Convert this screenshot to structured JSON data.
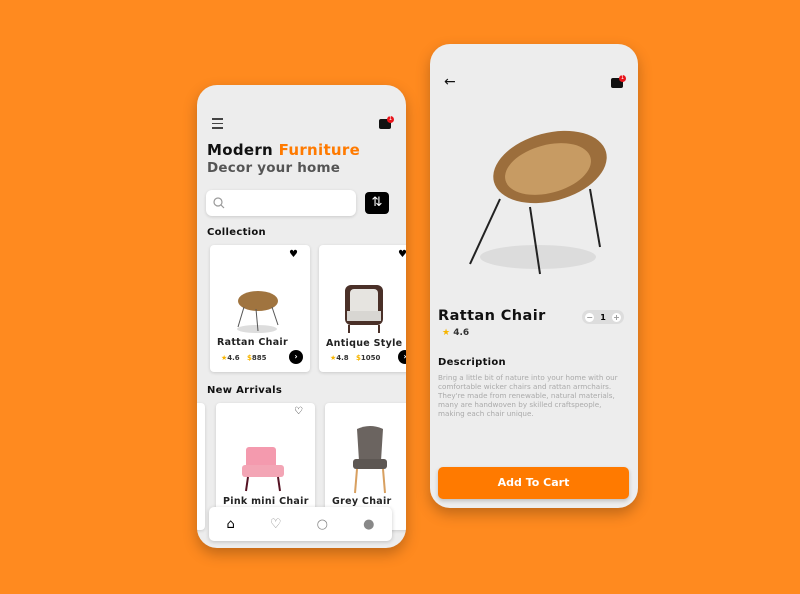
{
  "home": {
    "title_part1": "Modern",
    "title_part2": "Furniture",
    "subtitle": "Decor your home",
    "cart_badge": "1",
    "sort_icon": "⇅",
    "collection_label": "Collection",
    "collection": [
      {
        "name": "Rattan Chair",
        "rating": "4.6",
        "currency": "$",
        "price": "885"
      },
      {
        "name": "Antique Style",
        "rating": "4.8",
        "currency": "$",
        "price": "1050"
      }
    ],
    "new_arrivals_label": "New Arrivals",
    "new_arrivals": [
      {
        "name": "Pink mini Chair"
      },
      {
        "name": "Grey Chair"
      }
    ],
    "nav": [
      "home",
      "favorites",
      "search",
      "profile"
    ]
  },
  "detail": {
    "cart_badge": "1",
    "name": "Rattan Chair",
    "rating": "4.6",
    "quantity": "1",
    "minus": "−",
    "plus": "+",
    "description_label": "Description",
    "description": "Bring a little bit of nature into your home with our comfortable wicker chairs and rattan armchairs. They're made from renewable, natural materials, many are handwoven by skilled craftspeople, making each chair unique.",
    "add_to_cart": "Add To Cart"
  },
  "colors": {
    "background": "#FF8A1F",
    "accent": "#FF7A00",
    "star": "#F7B500"
  }
}
